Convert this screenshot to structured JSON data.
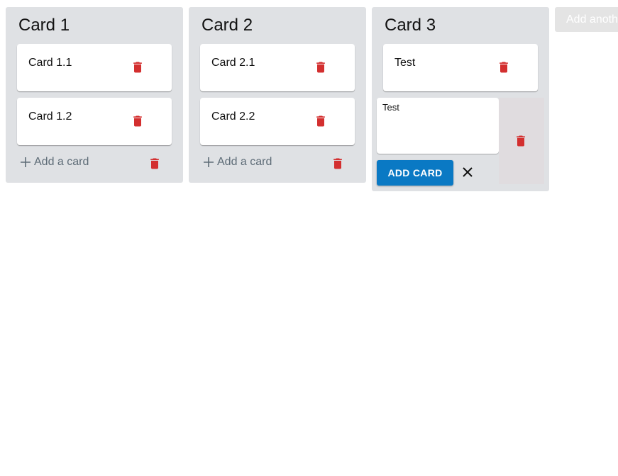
{
  "colors": {
    "trash": "#d32f2f",
    "list_bg": "#dfe1e4",
    "primary": "#0a79c4"
  },
  "lists": [
    {
      "title": "Card 1",
      "cards": [
        {
          "text": "Card 1.1"
        },
        {
          "text": "Card 1.2"
        }
      ],
      "add_card_label": "Add a card"
    },
    {
      "title": "Card 2",
      "cards": [
        {
          "text": "Card 2.1"
        },
        {
          "text": "Card 2.2"
        }
      ],
      "add_card_label": "Add a card"
    },
    {
      "title": "Card 3",
      "cards": [
        {
          "text": "Test"
        }
      ],
      "composer": {
        "value": "Test",
        "add_button_label": "ADD CARD"
      }
    }
  ],
  "add_list_label": "Add another list",
  "icons": {
    "delete": "trash-icon",
    "add": "plus-icon",
    "close": "close-icon"
  }
}
